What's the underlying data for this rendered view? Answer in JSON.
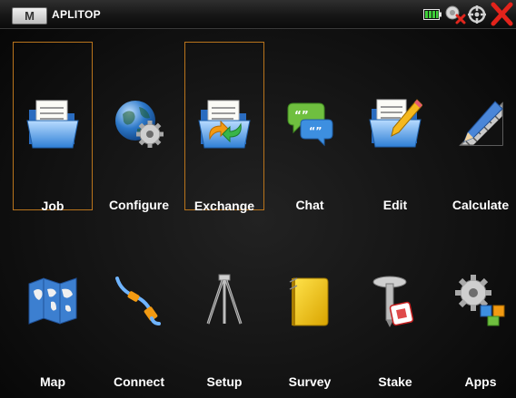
{
  "titlebar": {
    "menu_label": "M",
    "title": "APLITOP"
  },
  "menu": {
    "row1": [
      {
        "label": "Job",
        "icon": "folder-document-icon",
        "selected": true
      },
      {
        "label": "Configure",
        "icon": "globe-gear-icon",
        "selected": false
      },
      {
        "label": "Exchange",
        "icon": "folder-exchange-icon",
        "selected": true
      },
      {
        "label": "Chat",
        "icon": "chat-bubbles-icon",
        "selected": false
      },
      {
        "label": "Edit",
        "icon": "folder-edit-icon",
        "selected": false
      },
      {
        "label": "Calculate",
        "icon": "ruler-pencil-icon",
        "selected": false
      }
    ],
    "row2": [
      {
        "label": "Map",
        "icon": "world-map-icon"
      },
      {
        "label": "Connect",
        "icon": "cable-icon"
      },
      {
        "label": "Setup",
        "icon": "tripod-icon"
      },
      {
        "label": "Survey",
        "icon": "notebook-icon"
      },
      {
        "label": "Stake",
        "icon": "stake-pin-icon"
      },
      {
        "label": "Apps",
        "icon": "gear-blocks-icon"
      }
    ]
  },
  "colors": {
    "selection_border": "#b9741c",
    "background": "#111111",
    "label": "#ffffff"
  }
}
